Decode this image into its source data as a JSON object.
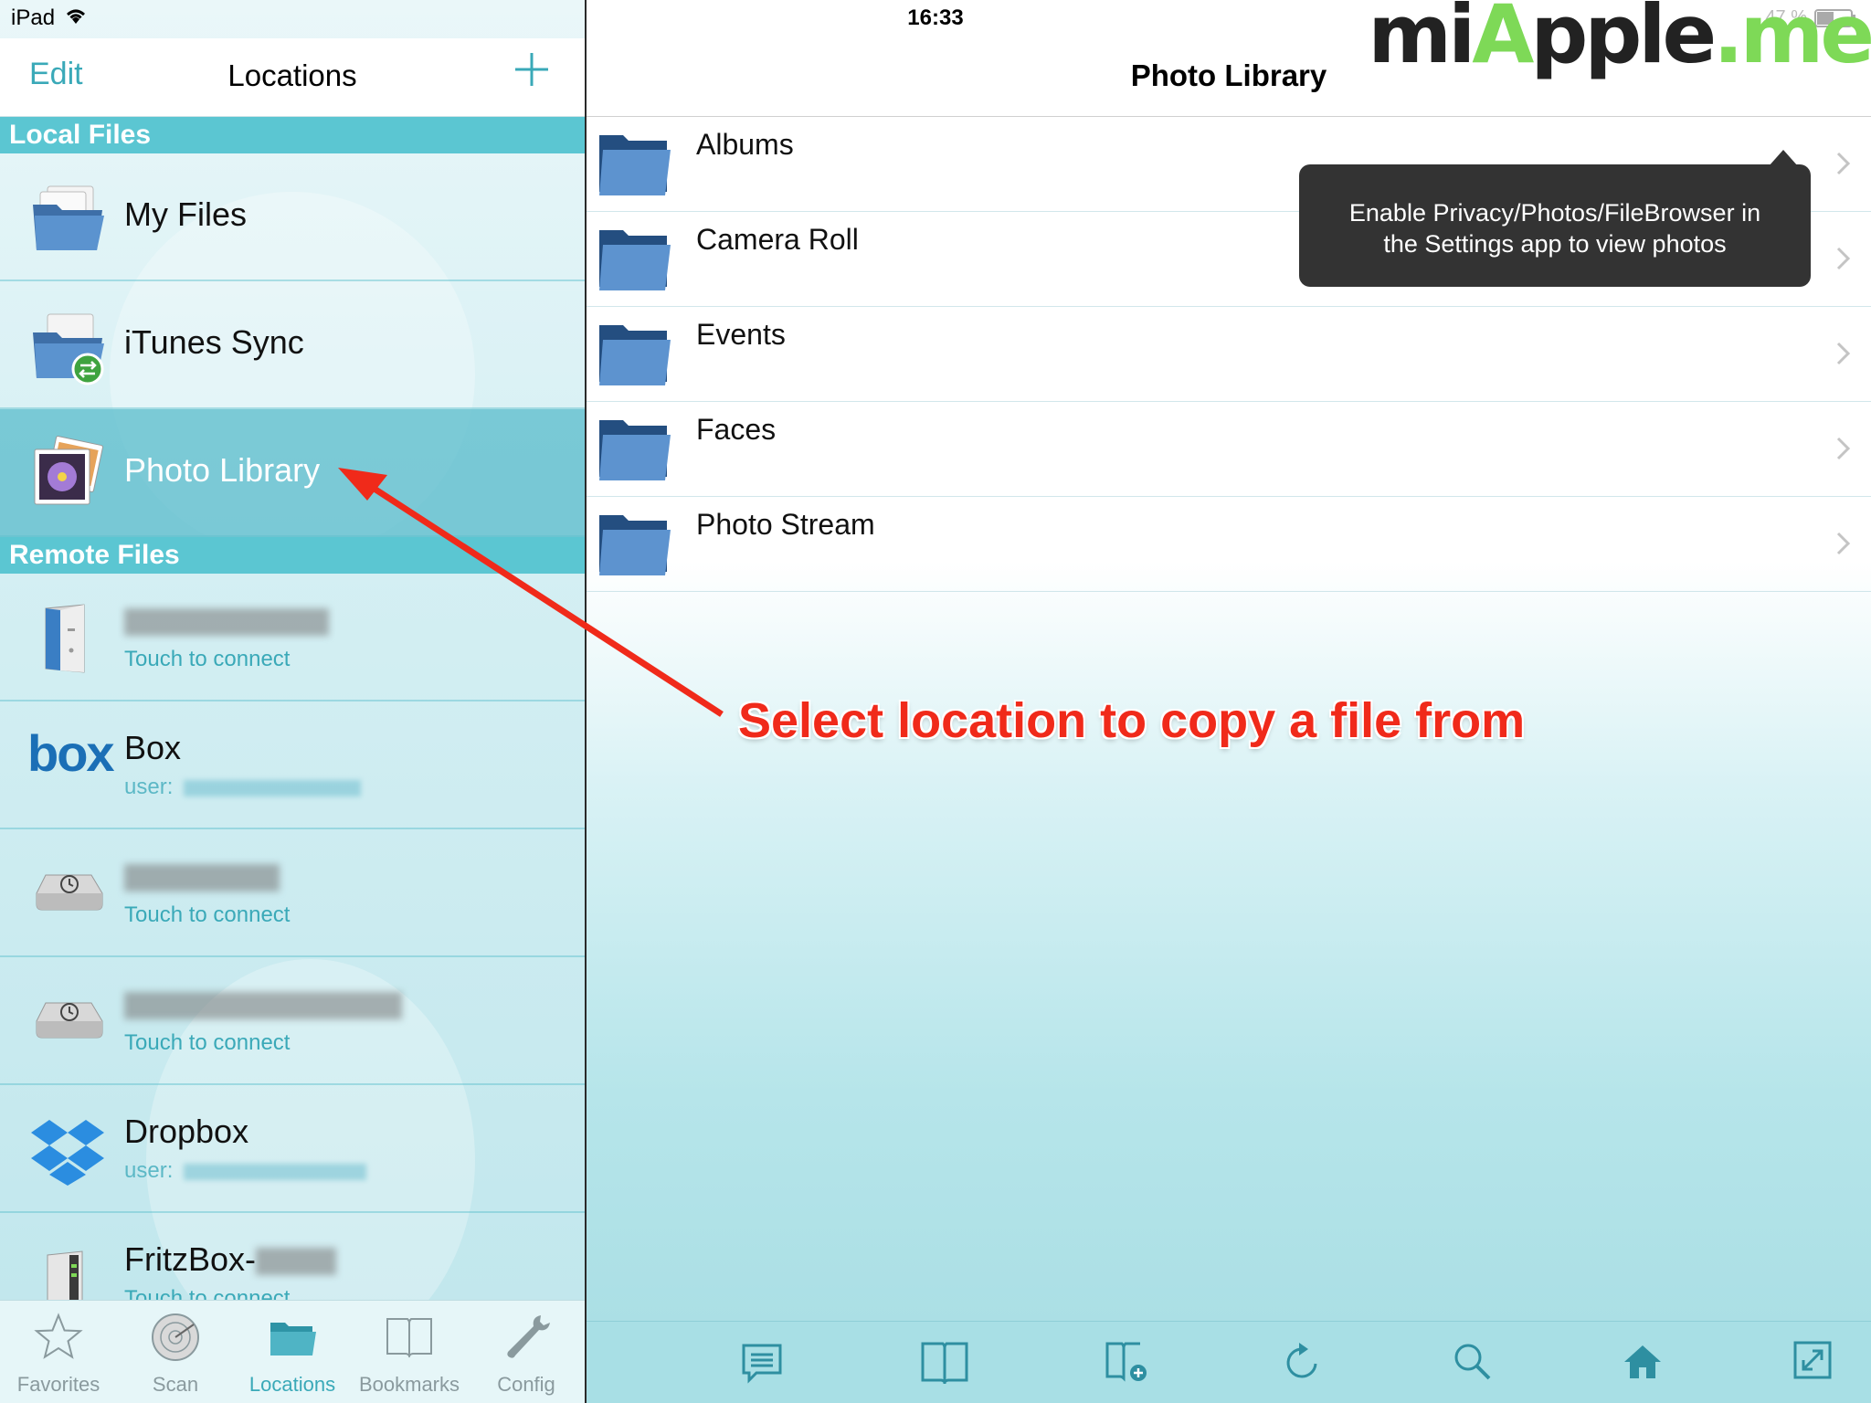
{
  "status_bar": {
    "device": "iPad",
    "time": "16:33",
    "battery": "47 %"
  },
  "watermark": {
    "part1": "mi",
    "part2": "A",
    "part3": "pple",
    "part4": ".me"
  },
  "left_header": {
    "edit_label": "Edit",
    "title": "Locations"
  },
  "sections": {
    "local": "Local Files",
    "remote": "Remote Files"
  },
  "local_items": [
    {
      "name": "My Files",
      "icon": "folder-stack-icon"
    },
    {
      "name": "iTunes Sync",
      "icon": "itunes-sync-icon"
    },
    {
      "name": "Photo Library",
      "icon": "photo-library-icon"
    }
  ],
  "remote_items": [
    {
      "name": "",
      "sub": "Touch to connect",
      "icon": "mac-pro-icon"
    },
    {
      "name": "Box",
      "sub": "user:",
      "icon": "box-logo-icon",
      "logo_text": "box"
    },
    {
      "name": "",
      "sub": "Touch to connect",
      "icon": "time-capsule-icon"
    },
    {
      "name": "",
      "sub": "Touch to connect",
      "icon": "time-capsule-icon"
    },
    {
      "name": "Dropbox",
      "sub": "user:",
      "icon": "dropbox-icon"
    },
    {
      "name": "FritzBox-",
      "sub": "Touch to connect",
      "icon": "router-icon"
    }
  ],
  "tabs": [
    {
      "label": "Favorites",
      "icon": "star-icon",
      "active": false
    },
    {
      "label": "Scan",
      "icon": "radar-icon",
      "active": false
    },
    {
      "label": "Locations",
      "icon": "folder-icon",
      "active": true
    },
    {
      "label": "Bookmarks",
      "icon": "book-icon",
      "active": false
    },
    {
      "label": "Config",
      "icon": "wrench-icon",
      "active": false
    }
  ],
  "right_header": {
    "title": "Photo Library"
  },
  "folders": [
    {
      "name": "Albums"
    },
    {
      "name": "Camera Roll"
    },
    {
      "name": "Events"
    },
    {
      "name": "Faces"
    },
    {
      "name": "Photo Stream"
    }
  ],
  "tooltip": {
    "line1": "Enable Privacy/Photos/FileBrowser in",
    "line2": "the Settings app to view photos"
  },
  "toolbar_icons": [
    "list-icon",
    "open-book-icon",
    "add-bookmark-icon",
    "refresh-icon",
    "search-icon",
    "home-icon",
    "fullscreen-icon"
  ],
  "annotation": {
    "text": "Select location to copy a file from",
    "color": "#f02a1a"
  },
  "colors": {
    "accent": "#3aa9b8",
    "section": "#5bc6d2",
    "selected_row": "#58bbcb"
  }
}
